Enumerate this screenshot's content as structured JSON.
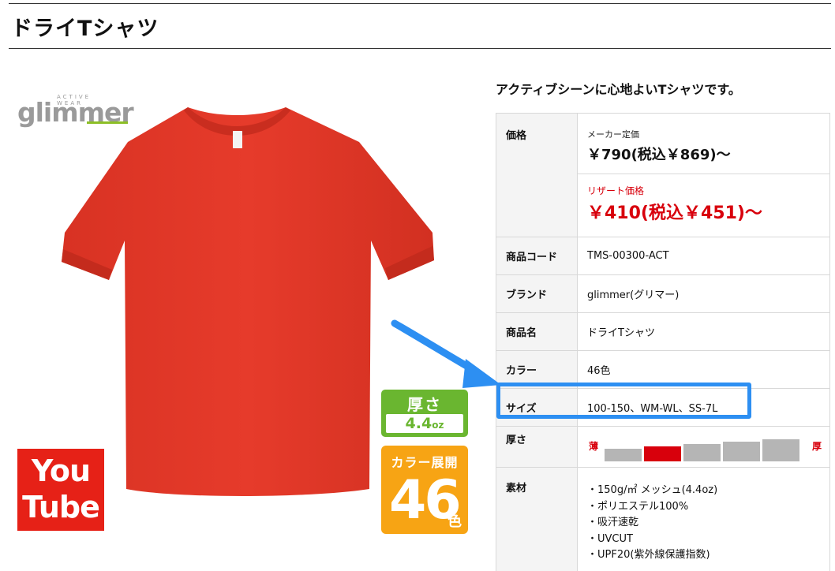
{
  "header": {
    "title": "ドライTシャツ"
  },
  "logo": {
    "tagline": "ACTIVE WEAR",
    "word": "glimmer"
  },
  "badges": {
    "thickness": {
      "label": "厚さ",
      "value": "4.4",
      "unit": "oz"
    },
    "colors": {
      "label": "カラー展開",
      "count": "46",
      "suffix": "色"
    },
    "youtube": {
      "line1": "You",
      "line2": "Tube"
    }
  },
  "product": {
    "catch_copy": "アクティブシーンに心地よいTシャツです。",
    "spec": {
      "price": {
        "label": "価格",
        "maker_label": "メーカー定価",
        "maker_value": "￥790(税込￥869)〜",
        "resort_label": "リザート価格",
        "resort_value": "￥410(税込￥451)〜"
      },
      "rows": [
        {
          "label": "商品コード",
          "value": "TMS-00300-ACT"
        },
        {
          "label": "ブランド",
          "value": "glimmer(グリマー)"
        },
        {
          "label": "商品名",
          "value": "ドライTシャツ"
        },
        {
          "label": "カラー",
          "value": "46色"
        },
        {
          "label": "サイズ",
          "value": "100-150、WM-WL、SS-7L"
        }
      ],
      "thickness": {
        "label": "厚さ",
        "thin": "薄",
        "thick": "厚",
        "level": 2,
        "levels": 5
      },
      "material": {
        "label": "素材",
        "items": [
          "・150g/㎡ メッシュ(4.4oz)",
          "・ポリエステル100%",
          "・吸汗速乾",
          "・UVCUT",
          "・UPF20(紫外線保護指数)"
        ]
      }
    }
  },
  "colors": {
    "accent_red": "#d8000c",
    "shirt_red": "#e5392a",
    "highlight_blue": "#2d8ff2",
    "badge_green": "#6ab630",
    "badge_orange": "#f7a414",
    "youtube_red": "#e62117"
  }
}
